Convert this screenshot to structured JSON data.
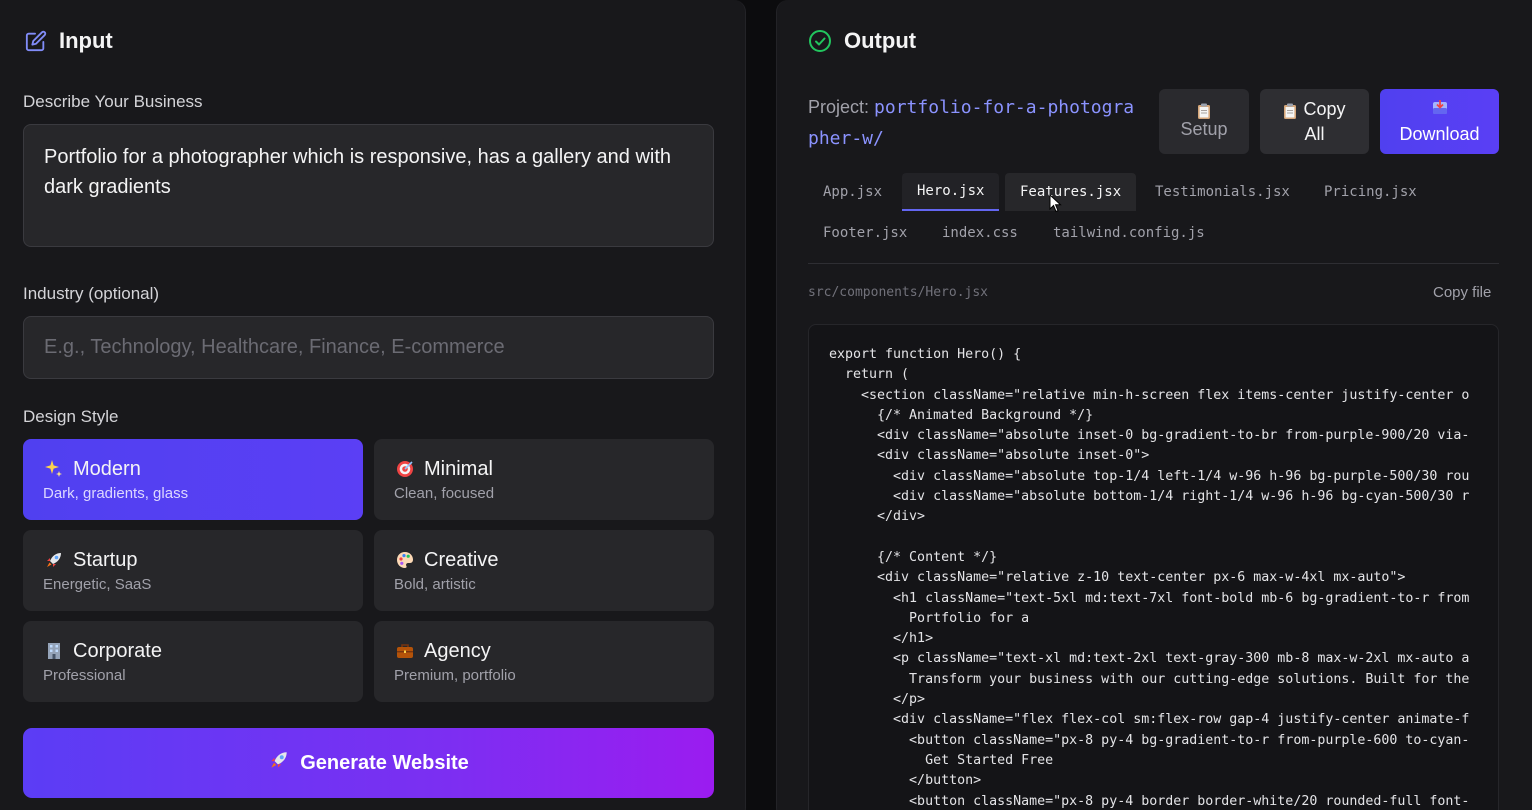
{
  "input_panel": {
    "title": "Input",
    "business": {
      "label": "Describe Your Business",
      "value": "Portfolio for a photographer which is responsive, has a gallery and with dark gradients"
    },
    "industry": {
      "label": "Industry (optional)",
      "placeholder": "E.g., Technology, Healthcare, Finance, E-commerce",
      "value": ""
    },
    "design_style": {
      "label": "Design Style",
      "selected": "Modern",
      "options": [
        {
          "name": "Modern",
          "desc": "Dark, gradients, glass",
          "icon": "sparkles-icon"
        },
        {
          "name": "Minimal",
          "desc": "Clean, focused",
          "icon": "target-icon"
        },
        {
          "name": "Startup",
          "desc": "Energetic, SaaS",
          "icon": "rocket-icon"
        },
        {
          "name": "Creative",
          "desc": "Bold, artistic",
          "icon": "palette-icon"
        },
        {
          "name": "Corporate",
          "desc": "Professional",
          "icon": "office-building-icon"
        },
        {
          "name": "Agency",
          "desc": "Premium, portfolio",
          "icon": "briefcase-icon"
        }
      ]
    },
    "generate_label": "Generate Website"
  },
  "output_panel": {
    "title": "Output",
    "project_label": "Project:",
    "project_name": "portfolio-for-a-photographer-w/",
    "buttons": {
      "setup": "Setup",
      "copy_all_1": "Copy",
      "copy_all_2": "All",
      "download": "Download"
    },
    "tabs": [
      "App.jsx",
      "Hero.jsx",
      "Features.jsx",
      "Testimonials.jsx",
      "Pricing.jsx",
      "Footer.jsx",
      "index.css",
      "tailwind.config.js"
    ],
    "active_tab": "Hero.jsx",
    "file_path": "src/components/Hero.jsx",
    "copy_file_label": "Copy file",
    "code_lines": [
      "export function Hero() {",
      "  return (",
      "    <section className=\"relative min-h-screen flex items-center justify-center o",
      "      {/* Animated Background */}",
      "      <div className=\"absolute inset-0 bg-gradient-to-br from-purple-900/20 via-",
      "      <div className=\"absolute inset-0\">",
      "        <div className=\"absolute top-1/4 left-1/4 w-96 h-96 bg-purple-500/30 rou",
      "        <div className=\"absolute bottom-1/4 right-1/4 w-96 h-96 bg-cyan-500/30 r",
      "      </div>",
      "",
      "      {/* Content */}",
      "      <div className=\"relative z-10 text-center px-6 max-w-4xl mx-auto\">",
      "        <h1 className=\"text-5xl md:text-7xl font-bold mb-6 bg-gradient-to-r from",
      "          Portfolio for a",
      "        </h1>",
      "        <p className=\"text-xl md:text-2xl text-gray-300 mb-8 max-w-2xl mx-auto a",
      "          Transform your business with our cutting-edge solutions. Built for the",
      "        </p>",
      "        <div className=\"flex flex-col sm:flex-row gap-4 justify-center animate-f",
      "          <button className=\"px-8 py-4 bg-gradient-to-r from-purple-600 to-cyan-",
      "            Get Started Free",
      "          </button>",
      "          <button className=\"px-8 py-4 border border-white/20 rounded-full font-"
    ]
  },
  "colors": {
    "accent": "#5040f0",
    "project_link": "#8b93ff",
    "output_check": "#22c55e",
    "input_icon": "#818cf8"
  }
}
